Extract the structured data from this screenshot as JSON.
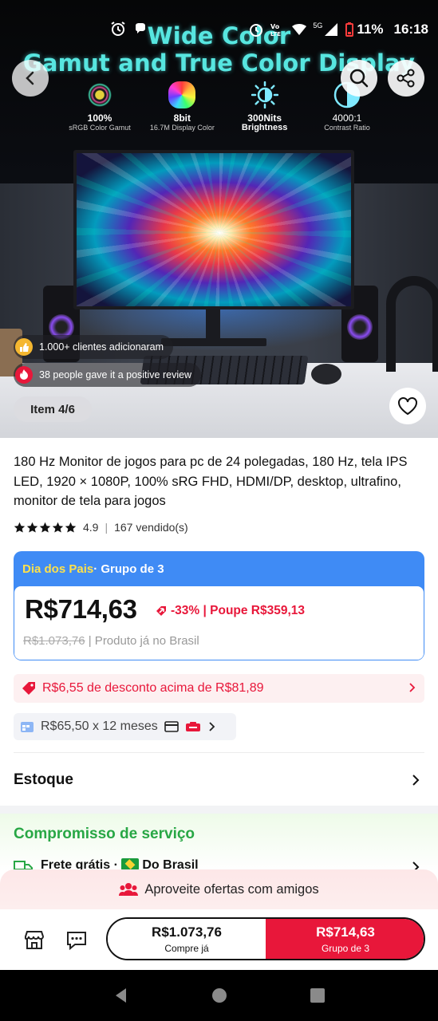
{
  "status_bar": {
    "battery": "11%",
    "time": "16:18",
    "network_label": "5G"
  },
  "hero": {
    "headline": "Wide Color\nGamut and True Color Display",
    "specs": [
      {
        "value": "100%",
        "label": "sRGB Color Gamut"
      },
      {
        "value": "8bit",
        "label": "16.7M Display Color"
      },
      {
        "value": "300Nits",
        "label": "Brightness"
      },
      {
        "value": "4000:1",
        "label": "Contrast Ratio"
      }
    ],
    "badge_added": "1.000+ clientes adicionaram",
    "badge_reviews": "38 people gave it a positive review",
    "item_counter": "Item 4/6"
  },
  "product": {
    "title": "180 Hz Monitor de jogos para pc de 24 polegadas, 180 Hz, tela IPS LED, 1920 × 1080P, 100% sRG FHD, HDMI/DP, desktop, ultrafino, monitor de tela para jogos",
    "rating": "4.9",
    "sold": "167 vendido(s)",
    "stars": 5
  },
  "promo": {
    "event": "Dia dos Pais",
    "group_label": " · Grupo de 3",
    "price": "R$714,63",
    "discount": "-33% | Poupe R$359,13",
    "old_price": "R$1.073,76",
    "old_note": " | Produto já no Brasil"
  },
  "coupon": {
    "text": "R$6,55 de desconto acima de R$81,89"
  },
  "installments": {
    "text": "R$65,50 x 12 meses"
  },
  "stock": {
    "label": "Estoque"
  },
  "service": {
    "title": "Compromisso de serviço",
    "shipping": "Frete grátis · ",
    "origin": "Do Brasil"
  },
  "friends": {
    "text": "Aproveite ofertas com amigos"
  },
  "buy": {
    "solo_price": "R$1.073,76",
    "solo_label": "Compre já",
    "group_price": "R$714,63",
    "group_label": "Grupo de 3"
  },
  "colors": {
    "accent_red": "#e8173a",
    "promo_blue": "#3f8bf5",
    "promo_yellow": "#ffe14a",
    "service_green": "#28a745",
    "headline_cyan": "#57e6e0"
  }
}
